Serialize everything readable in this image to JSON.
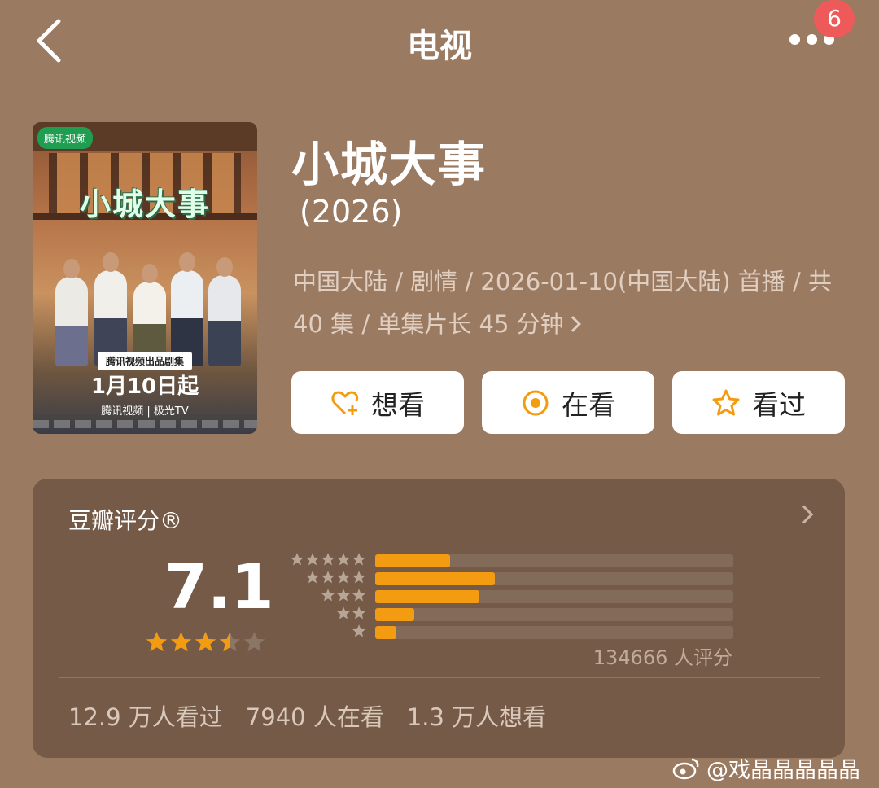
{
  "header": {
    "title": "电视",
    "badge": "6"
  },
  "poster": {
    "logo": "腾讯视频",
    "title": "小城大事",
    "band": "腾讯视频出品剧集",
    "date": "1月10日起",
    "footer": "腾讯视频 | 极光TV"
  },
  "movie": {
    "title": "小城大事",
    "year": "(2026)",
    "meta": "中国大陆 / 剧情 / 2026-01-10(中国大陆) 首播 / 共 40 集 / 单集片长 45 分钟"
  },
  "actions": [
    {
      "label": "想看",
      "icon": "heart-plus-icon"
    },
    {
      "label": "在看",
      "icon": "target-circle-icon"
    },
    {
      "label": "看过",
      "icon": "star-outline-icon"
    }
  ],
  "rating": {
    "title": "豆瓣评分®",
    "score": "7.1",
    "stars": 3.5,
    "distribution_fraction": [
      0.21,
      0.335,
      0.29,
      0.11,
      0.06
    ],
    "raters": "134666 人评分",
    "stats": [
      "12.9 万人看过",
      "7940 人在看",
      "1.3 万人想看"
    ]
  },
  "colors": {
    "background": "#9b7a62",
    "accent": "#f39c12",
    "badge": "#ee5a5a"
  },
  "watermark": "@戏晶晶晶晶晶"
}
